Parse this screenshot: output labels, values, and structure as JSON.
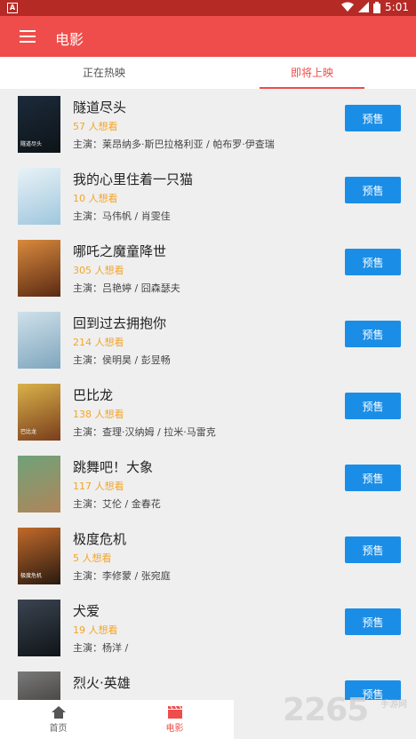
{
  "status": {
    "time": "5:01",
    "notification_letter": "A"
  },
  "appbar": {
    "title": "电影"
  },
  "tabs": [
    {
      "label": "正在热映"
    },
    {
      "label": "即将上映"
    }
  ],
  "movies": [
    {
      "title": "隧道尽头",
      "want": "57 人想看",
      "cast": "主演：莱昂纳多·斯巴拉格利亚 / 帕布罗·伊查瑞",
      "button": "预售",
      "poster_tag": "隧道尽头",
      "poster_colors": [
        "#1c2a3a",
        "#0d1418"
      ]
    },
    {
      "title": "我的心里住着一只猫",
      "want": "10 人想看",
      "cast": "主演：马伟帆 / 肖雯佳",
      "button": "预售",
      "poster_tag": "",
      "poster_colors": [
        "#e8f2f7",
        "#9fc7dd"
      ]
    },
    {
      "title": "哪吒之魔童降世",
      "want": "305 人想看",
      "cast": "主演：吕艳婷 / 囧森瑟夫",
      "button": "预售",
      "poster_tag": "",
      "poster_colors": [
        "#d98a3c",
        "#5a2a14"
      ]
    },
    {
      "title": "回到过去拥抱你",
      "want": "214 人想看",
      "cast": "主演：侯明昊 / 彭昱畅",
      "button": "预售",
      "poster_tag": "",
      "poster_colors": [
        "#cfe0ea",
        "#7fa6bd"
      ]
    },
    {
      "title": "巴比龙",
      "want": "138 人想看",
      "cast": "主演：查理·汉纳姆 / 拉米·马雷克",
      "button": "预售",
      "poster_tag": "巴比龙",
      "poster_colors": [
        "#d9b24a",
        "#7a3d1c"
      ]
    },
    {
      "title": "跳舞吧！大象",
      "want": "117 人想看",
      "cast": "主演：艾伦 / 金春花",
      "button": "预售",
      "poster_tag": "",
      "poster_colors": [
        "#6fa27a",
        "#b0855a"
      ]
    },
    {
      "title": "极度危机",
      "want": "5 人想看",
      "cast": "主演：李修蒙 / 张宛庭",
      "button": "预售",
      "poster_tag": "极度危机",
      "poster_colors": [
        "#c16a2a",
        "#2a1a10"
      ]
    },
    {
      "title": "犬爱",
      "want": "19 人想看",
      "cast": "主演：杨洋 /",
      "button": "预售",
      "poster_tag": "",
      "poster_colors": [
        "#3a4450",
        "#101418"
      ]
    },
    {
      "title": "烈火·英雄",
      "want": "",
      "cast": "",
      "button": "预售",
      "poster_tag": "",
      "poster_colors": [
        "#7a7a7a",
        "#2e2a26"
      ]
    }
  ],
  "bottomnav": [
    {
      "label": "首页",
      "icon": "home-icon"
    },
    {
      "label": "电影",
      "icon": "clapperboard-icon"
    }
  ],
  "watermark": {
    "text": "2265",
    "sub": "手游网"
  },
  "colors": {
    "primary": "#ef4d4b",
    "status_bar": "#b62a26",
    "button": "#1a8ee7",
    "want": "#f3a528"
  }
}
